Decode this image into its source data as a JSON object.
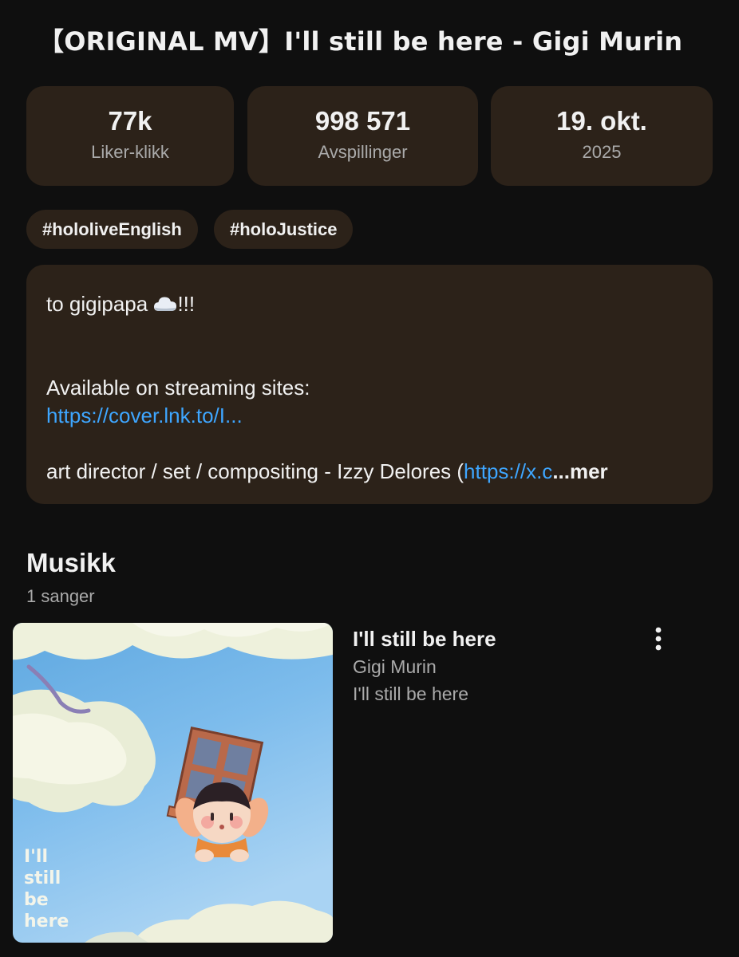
{
  "video": {
    "title": "【ORIGINAL MV】I'll still be here - Gigi Murin"
  },
  "stats": {
    "likes": {
      "value": "77k",
      "label": "Liker-klikk"
    },
    "views": {
      "value": "998 571",
      "label": "Avspillinger"
    },
    "date": {
      "value": "19. okt.",
      "label": "2025"
    }
  },
  "tags": [
    "#hololiveEnglish",
    "#holoJustice"
  ],
  "description": {
    "line1_text": "to gigipapa ",
    "line1_emoji": "cloud-icon",
    "line1_suffix": "!!!",
    "line2": "Available on streaming sites:",
    "link1": "https://cover.lnk.to/I...",
    "line3_text": "art director / set / compositing - Izzy Delores (",
    "line3_link": "https://x.c",
    "more_label": "...mer"
  },
  "music": {
    "heading": "Musikk",
    "count": "1 sanger",
    "song": {
      "title": "I'll still be here",
      "artist": "Gigi Murin",
      "album": "I'll still be here",
      "cover_text": [
        "I'll",
        "still",
        "be",
        "here"
      ]
    }
  },
  "icons": {
    "more": "more-vertical-icon"
  },
  "colors": {
    "background": "#0f0f0f",
    "card": "#2c2219",
    "link": "#3ea6ff",
    "secondary_text": "#aaaaaa",
    "primary_text": "#f1f1f1"
  }
}
